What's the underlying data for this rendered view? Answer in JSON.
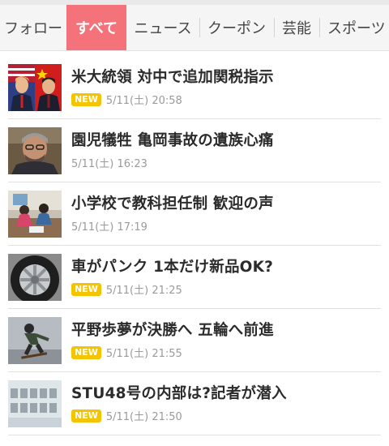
{
  "tabs": [
    {
      "label": "フォロー",
      "active": false
    },
    {
      "label": "すべて",
      "active": true
    },
    {
      "label": "ニュース",
      "active": false
    },
    {
      "label": "クーポン",
      "active": false
    },
    {
      "label": "芸能",
      "active": false
    },
    {
      "label": "スポーツ",
      "active": false
    }
  ],
  "news": [
    {
      "title": "米大統領 対中で追加関税指示",
      "badge": "NEW",
      "time": "5/11(土) 20:58",
      "thumb": "leaders-photo"
    },
    {
      "title": "園児犠牲 亀岡事故の遺族心痛",
      "badge": "",
      "time": "5/11(土) 16:23",
      "thumb": "man-portrait-photo"
    },
    {
      "title": "小学校で教科担任制 歓迎の声",
      "badge": "",
      "time": "5/11(土) 17:19",
      "thumb": "classroom-photo"
    },
    {
      "title": "車がパンク 1本だけ新品OK?",
      "badge": "NEW",
      "time": "5/11(土) 21:25",
      "thumb": "tire-photo"
    },
    {
      "title": "平野歩夢が決勝へ 五輪へ前進",
      "badge": "NEW",
      "time": "5/11(土) 21:55",
      "thumb": "skateboard-photo"
    },
    {
      "title": "STU48号の内部は?記者が潜入",
      "badge": "NEW",
      "time": "5/11(土) 21:50",
      "thumb": "gallery-photo"
    }
  ],
  "colors": {
    "accent": "#f4727a",
    "new_badge": "#f5c400"
  }
}
